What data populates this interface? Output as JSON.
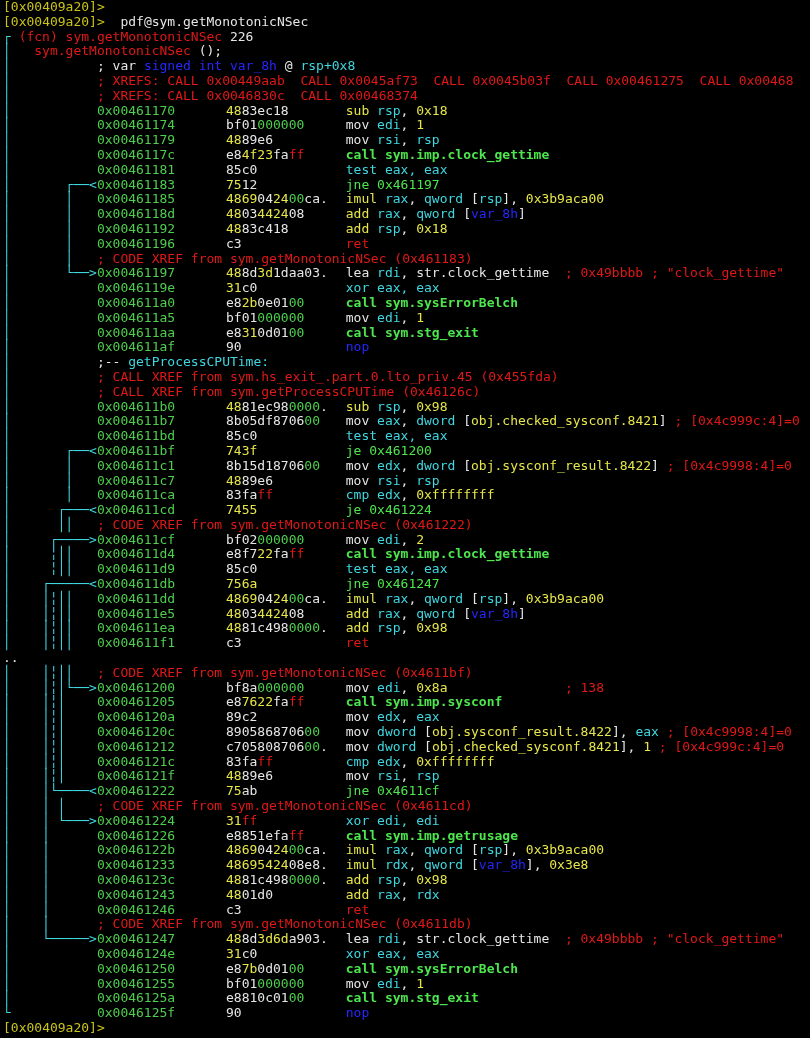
{
  "lines": [
    {
      "kind": "prompt",
      "prompt": "[0x00409a20]>"
    },
    {
      "kind": "prompt",
      "prompt": "[0x00409a20]>",
      "command": "pdf@sym.getMonotonicNSec"
    },
    {
      "kind": "header",
      "graph": "┌",
      "parts": [
        {
          "text": "(fcn) sym.getMonotonicNSec ",
          "kind": "fn"
        },
        {
          "text": "226",
          "kind": "punct"
        }
      ]
    },
    {
      "kind": "signature",
      "graph": "│",
      "parts": [
        {
          "text": "sym.getMonotonicNSec",
          "kind": "fn"
        },
        {
          "text": " ();",
          "kind": "punct"
        }
      ]
    },
    {
      "kind": "note",
      "graph": "│",
      "parts": [
        {
          "text": "; var ",
          "kind": "punct"
        },
        {
          "text": "signed int var_8h",
          "kind": "var"
        },
        {
          "text": " @ ",
          "kind": "punct"
        },
        {
          "text": "rsp+0x8",
          "kind": "reg"
        }
      ]
    },
    {
      "kind": "xref",
      "graph": "│",
      "parts": [
        {
          "text": "; XREFS: CALL 0x00449aab  CALL 0x0045af73  CALL 0x0045b03f  CALL 0x00461275  CALL 0x00468",
          "kind": "xref"
        }
      ]
    },
    {
      "kind": "xref",
      "graph": "│",
      "parts": [
        {
          "text": "; XREFS: CALL 0x0046830c  CALL 0x00468374",
          "kind": "xref"
        }
      ]
    },
    {
      "kind": "instr",
      "graph": "│",
      "addr": "0x00461170",
      "bytes": "4883ec18",
      "asm": [
        {
          "text": "sub ",
          "kind": "arith"
        },
        {
          "text": "rsp",
          "kind": "reg"
        },
        {
          "text": ", ",
          "kind": "punct"
        },
        {
          "text": "0x18",
          "kind": "num"
        }
      ]
    },
    {
      "kind": "instr",
      "graph": "│",
      "addr": "0x00461174",
      "bytes": "bf01000000",
      "asm": [
        {
          "text": "mov ",
          "kind": "op"
        },
        {
          "text": "edi",
          "kind": "reg"
        },
        {
          "text": ", ",
          "kind": "punct"
        },
        {
          "text": "1",
          "kind": "num"
        }
      ]
    },
    {
      "kind": "instr",
      "graph": "│",
      "addr": "0x00461179",
      "bytes": "4889e6",
      "asm": [
        {
          "text": "mov ",
          "kind": "op"
        },
        {
          "text": "rsi",
          "kind": "reg"
        },
        {
          "text": ", ",
          "kind": "punct"
        },
        {
          "text": "rsp",
          "kind": "reg"
        }
      ]
    },
    {
      "kind": "instr",
      "graph": "│",
      "addr": "0x0046117c",
      "bytes": "e84f23faff",
      "asm": [
        {
          "text": "call sym.imp.clock_gettime",
          "kind": "call"
        }
      ]
    },
    {
      "kind": "instr",
      "graph": "│",
      "addr": "0x00461181",
      "bytes": "85c0",
      "asm": [
        {
          "text": "test eax, eax",
          "kind": "logic"
        }
      ]
    },
    {
      "kind": "instr",
      "graph": "│       ┌──<",
      "addr": "0x00461183",
      "bytes": "7512",
      "asm": [
        {
          "text": "jne 0x461197",
          "kind": "jump"
        }
      ]
    },
    {
      "kind": "instr",
      "graph": "│       │",
      "addr": "0x00461185",
      "bytes": "4869042400ca.",
      "asm": [
        {
          "text": "imul ",
          "kind": "arith"
        },
        {
          "text": "rax",
          "kind": "reg"
        },
        {
          "text": ", ",
          "kind": "punct"
        },
        {
          "text": "qword ",
          "kind": "reg"
        },
        {
          "text": "[",
          "kind": "punct"
        },
        {
          "text": "rsp",
          "kind": "reg"
        },
        {
          "text": "], ",
          "kind": "punct"
        },
        {
          "text": "0x3b9aca00",
          "kind": "num"
        }
      ]
    },
    {
      "kind": "instr",
      "graph": "│       │",
      "addr": "0x0046118d",
      "bytes": "4803442408",
      "asm": [
        {
          "text": "add ",
          "kind": "arith"
        },
        {
          "text": "rax",
          "kind": "reg"
        },
        {
          "text": ", ",
          "kind": "punct"
        },
        {
          "text": "qword ",
          "kind": "reg"
        },
        {
          "text": "[",
          "kind": "punct"
        },
        {
          "text": "var_8h",
          "kind": "var"
        },
        {
          "text": "]",
          "kind": "punct"
        }
      ]
    },
    {
      "kind": "instr",
      "graph": "│       │",
      "addr": "0x00461192",
      "bytes": "4883c418",
      "asm": [
        {
          "text": "add ",
          "kind": "arith"
        },
        {
          "text": "rsp",
          "kind": "reg"
        },
        {
          "text": ", ",
          "kind": "punct"
        },
        {
          "text": "0x18",
          "kind": "num"
        }
      ]
    },
    {
      "kind": "instr",
      "graph": "│       │",
      "addr": "0x00461196",
      "bytes": "c3",
      "asm": [
        {
          "text": "ret",
          "kind": "ret"
        }
      ]
    },
    {
      "kind": "xref",
      "graph": "│       │",
      "parts": [
        {
          "text": "; CODE XREF from sym.getMonotonicNSec (0x461183)",
          "kind": "xref"
        }
      ]
    },
    {
      "kind": "instr",
      "graph": "│       └──>",
      "addr": "0x00461197",
      "bytes": "488d3d1daa03.",
      "asm": [
        {
          "text": "lea ",
          "kind": "op"
        },
        {
          "text": "rdi",
          "kind": "reg"
        },
        {
          "text": ", ",
          "kind": "punct"
        },
        {
          "text": "str.clock_gettime",
          "kind": "punct"
        }
      ],
      "comment": "; 0x49bbbb ; \"clock_gettime\""
    },
    {
      "kind": "instr",
      "graph": "│",
      "addr": "0x0046119e",
      "bytes": "31c0",
      "asm": [
        {
          "text": "xor eax, eax",
          "kind": "logic"
        }
      ]
    },
    {
      "kind": "instr",
      "graph": "│",
      "addr": "0x004611a0",
      "bytes": "e82b0e0100",
      "asm": [
        {
          "text": "call sym.sysErrorBelch",
          "kind": "call"
        }
      ]
    },
    {
      "kind": "instr",
      "graph": "│",
      "addr": "0x004611a5",
      "bytes": "bf01000000",
      "asm": [
        {
          "text": "mov ",
          "kind": "op"
        },
        {
          "text": "edi",
          "kind": "reg"
        },
        {
          "text": ", ",
          "kind": "punct"
        },
        {
          "text": "1",
          "kind": "num"
        }
      ]
    },
    {
      "kind": "instr",
      "graph": "│",
      "addr": "0x004611aa",
      "bytes": "e8310d0100",
      "asm": [
        {
          "text": "call sym.stg_exit",
          "kind": "call"
        }
      ]
    },
    {
      "kind": "instr",
      "graph": "│",
      "addr": "0x004611af",
      "bytes": "90",
      "asm": [
        {
          "text": "nop",
          "kind": "nop"
        }
      ]
    },
    {
      "kind": "label",
      "graph": "│",
      "parts": [
        {
          "text": ";-- ",
          "kind": "punct"
        },
        {
          "text": "getProcessCPUTime:",
          "kind": "reg"
        }
      ]
    },
    {
      "kind": "xref",
      "graph": "│",
      "parts": [
        {
          "text": "; CALL XREF from sym.hs_exit_.part.0.lto_priv.45 (0x455fda)",
          "kind": "xref"
        }
      ]
    },
    {
      "kind": "xref",
      "graph": "│",
      "parts": [
        {
          "text": "; CALL XREF from sym.getProcessCPUTime (0x46126c)",
          "kind": "xref"
        }
      ]
    },
    {
      "kind": "instr",
      "graph": "│",
      "addr": "0x004611b0",
      "bytes": "4881ec980000.",
      "asm": [
        {
          "text": "sub ",
          "kind": "arith"
        },
        {
          "text": "rsp",
          "kind": "reg"
        },
        {
          "text": ", ",
          "kind": "punct"
        },
        {
          "text": "0x98",
          "kind": "num"
        }
      ]
    },
    {
      "kind": "instr",
      "graph": "│",
      "addr": "0x004611b7",
      "bytes": "8b05df870600",
      "asm": [
        {
          "text": "mov ",
          "kind": "op"
        },
        {
          "text": "eax",
          "kind": "reg"
        },
        {
          "text": ", ",
          "kind": "punct"
        },
        {
          "text": "dword ",
          "kind": "reg"
        },
        {
          "text": "[",
          "kind": "punct"
        },
        {
          "text": "obj.checked_sysconf.8421",
          "kind": "obj"
        },
        {
          "text": "]",
          "kind": "punct"
        }
      ],
      "comment": "; [0x4c999c:4]=0"
    },
    {
      "kind": "instr",
      "graph": "│",
      "addr": "0x004611bd",
      "bytes": "85c0",
      "asm": [
        {
          "text": "test eax, eax",
          "kind": "logic"
        }
      ]
    },
    {
      "kind": "instr",
      "graph": "│       ┌──<",
      "addr": "0x004611bf",
      "bytes": "743f",
      "asm": [
        {
          "text": "je 0x461200",
          "kind": "jump"
        }
      ]
    },
    {
      "kind": "instr",
      "graph": "│       │",
      "addr": "0x004611c1",
      "bytes": "8b15d1870600",
      "asm": [
        {
          "text": "mov ",
          "kind": "op"
        },
        {
          "text": "edx",
          "kind": "reg"
        },
        {
          "text": ", ",
          "kind": "punct"
        },
        {
          "text": "dword ",
          "kind": "reg"
        },
        {
          "text": "[",
          "kind": "punct"
        },
        {
          "text": "obj.sysconf_result.8422",
          "kind": "obj"
        },
        {
          "text": "]",
          "kind": "punct"
        }
      ],
      "comment": "; [0x4c9998:4]=0"
    },
    {
      "kind": "instr",
      "graph": "│       │",
      "addr": "0x004611c7",
      "bytes": "4889e6",
      "asm": [
        {
          "text": "mov ",
          "kind": "op"
        },
        {
          "text": "rsi",
          "kind": "reg"
        },
        {
          "text": ", ",
          "kind": "punct"
        },
        {
          "text": "rsp",
          "kind": "reg"
        }
      ]
    },
    {
      "kind": "instr",
      "graph": "│       │",
      "addr": "0x004611ca",
      "bytes": "83faff",
      "asm": [
        {
          "text": "cmp ",
          "kind": "logic"
        },
        {
          "text": "edx",
          "kind": "reg"
        },
        {
          "text": ", ",
          "kind": "punct"
        },
        {
          "text": "0xffffffff",
          "kind": "num"
        }
      ]
    },
    {
      "kind": "instr",
      "graph": "│      ┌───<",
      "addr": "0x004611cd",
      "bytes": "7455",
      "asm": [
        {
          "text": "je 0x461224",
          "kind": "jump"
        }
      ]
    },
    {
      "kind": "xref",
      "graph": "│      ││",
      "parts": [
        {
          "text": "; CODE XREF from sym.getMonotonicNSec (0x461222)",
          "kind": "xref"
        }
      ]
    },
    {
      "kind": "instr",
      "graph": "│     ┌────>",
      "addr": "0x004611cf",
      "bytes": "bf02000000",
      "asm": [
        {
          "text": "mov ",
          "kind": "op"
        },
        {
          "text": "edi",
          "kind": "reg"
        },
        {
          "text": ", ",
          "kind": "punct"
        },
        {
          "text": "2",
          "kind": "num"
        }
      ]
    },
    {
      "kind": "instr",
      "graph": "│     ╎││",
      "addr": "0x004611d4",
      "bytes": "e8f722faff",
      "asm": [
        {
          "text": "call sym.imp.clock_gettime",
          "kind": "call"
        }
      ]
    },
    {
      "kind": "instr",
      "graph": "│     ╎││",
      "addr": "0x004611d9",
      "bytes": "85c0",
      "asm": [
        {
          "text": "test eax, eax",
          "kind": "logic"
        }
      ]
    },
    {
      "kind": "instr",
      "graph": "│    ┌─────<",
      "addr": "0x004611db",
      "bytes": "756a",
      "asm": [
        {
          "text": "jne 0x461247",
          "kind": "jump"
        }
      ]
    },
    {
      "kind": "instr",
      "graph": "│    │╎││",
      "addr": "0x004611dd",
      "bytes": "4869042400ca.",
      "asm": [
        {
          "text": "imul ",
          "kind": "arith"
        },
        {
          "text": "rax",
          "kind": "reg"
        },
        {
          "text": ", ",
          "kind": "punct"
        },
        {
          "text": "qword ",
          "kind": "reg"
        },
        {
          "text": "[",
          "kind": "punct"
        },
        {
          "text": "rsp",
          "kind": "reg"
        },
        {
          "text": "], ",
          "kind": "punct"
        },
        {
          "text": "0x3b9aca00",
          "kind": "num"
        }
      ]
    },
    {
      "kind": "instr",
      "graph": "│    │╎││",
      "addr": "0x004611e5",
      "bytes": "4803442408",
      "asm": [
        {
          "text": "add ",
          "kind": "arith"
        },
        {
          "text": "rax",
          "kind": "reg"
        },
        {
          "text": ", ",
          "kind": "punct"
        },
        {
          "text": "qword ",
          "kind": "reg"
        },
        {
          "text": "[",
          "kind": "punct"
        },
        {
          "text": "var_8h",
          "kind": "var"
        },
        {
          "text": "]",
          "kind": "punct"
        }
      ]
    },
    {
      "kind": "instr",
      "graph": "│    │╎││",
      "addr": "0x004611ea",
      "bytes": "4881c4980000.",
      "asm": [
        {
          "text": "add ",
          "kind": "arith"
        },
        {
          "text": "rsp",
          "kind": "reg"
        },
        {
          "text": ", ",
          "kind": "punct"
        },
        {
          "text": "0x98",
          "kind": "num"
        }
      ]
    },
    {
      "kind": "instr",
      "graph": "│    │╎││",
      "addr": "0x004611f1",
      "bytes": "c3",
      "asm": [
        {
          "text": "ret",
          "kind": "ret"
        }
      ]
    },
    {
      "kind": "dots",
      "text": ".."
    },
    {
      "kind": "xref",
      "graph": "│    │╎││",
      "parts": [
        {
          "text": "; CODE XREF from sym.getMonotonicNSec (0x4611bf)",
          "kind": "xref"
        }
      ]
    },
    {
      "kind": "instr",
      "graph": "│    │╎│└──>",
      "addr": "0x00461200",
      "bytes": "bf8a000000",
      "asm": [
        {
          "text": "mov ",
          "kind": "op"
        },
        {
          "text": "edi",
          "kind": "reg"
        },
        {
          "text": ", ",
          "kind": "punct"
        },
        {
          "text": "0x8a",
          "kind": "num"
        }
      ],
      "comment": "; 138"
    },
    {
      "kind": "instr",
      "graph": "│    │╎│",
      "addr": "0x00461205",
      "bytes": "e87622faff",
      "asm": [
        {
          "text": "call sym.imp.sysconf",
          "kind": "call"
        }
      ]
    },
    {
      "kind": "instr",
      "graph": "│    │╎│",
      "addr": "0x0046120a",
      "bytes": "89c2",
      "asm": [
        {
          "text": "mov ",
          "kind": "op"
        },
        {
          "text": "edx",
          "kind": "reg"
        },
        {
          "text": ", ",
          "kind": "punct"
        },
        {
          "text": "eax",
          "kind": "reg"
        }
      ]
    },
    {
      "kind": "instr",
      "graph": "│    │╎│",
      "addr": "0x0046120c",
      "bytes": "890586870600",
      "asm": [
        {
          "text": "mov ",
          "kind": "op"
        },
        {
          "text": "dword ",
          "kind": "reg"
        },
        {
          "text": "[",
          "kind": "punct"
        },
        {
          "text": "obj.sysconf_result.8422",
          "kind": "obj"
        },
        {
          "text": "], ",
          "kind": "punct"
        },
        {
          "text": "eax",
          "kind": "reg"
        }
      ],
      "comment": "; [0x4c9998:4]=0"
    },
    {
      "kind": "instr",
      "graph": "│    │╎│",
      "addr": "0x00461212",
      "bytes": "c70580870600.",
      "asm": [
        {
          "text": "mov ",
          "kind": "op"
        },
        {
          "text": "dword ",
          "kind": "reg"
        },
        {
          "text": "[",
          "kind": "punct"
        },
        {
          "text": "obj.checked_sysconf.8421",
          "kind": "obj"
        },
        {
          "text": "], ",
          "kind": "punct"
        },
        {
          "text": "1",
          "kind": "num"
        }
      ],
      "comment": "; [0x4c999c:4]=0"
    },
    {
      "kind": "instr",
      "graph": "│    │╎│",
      "addr": "0x0046121c",
      "bytes": "83faff",
      "asm": [
        {
          "text": "cmp ",
          "kind": "logic"
        },
        {
          "text": "edx",
          "kind": "reg"
        },
        {
          "text": ", ",
          "kind": "punct"
        },
        {
          "text": "0xffffffff",
          "kind": "num"
        }
      ]
    },
    {
      "kind": "instr",
      "graph": "│    │╎│",
      "addr": "0x0046121f",
      "bytes": "4889e6",
      "asm": [
        {
          "text": "mov ",
          "kind": "op"
        },
        {
          "text": "rsi",
          "kind": "reg"
        },
        {
          "text": ", ",
          "kind": "punct"
        },
        {
          "text": "rsp",
          "kind": "reg"
        }
      ]
    },
    {
      "kind": "instr",
      "graph": "│    │└────<",
      "addr": "0x00461222",
      "bytes": "75ab",
      "asm": [
        {
          "text": "jne 0x4611cf",
          "kind": "jump"
        }
      ]
    },
    {
      "kind": "xref",
      "graph": "│    │ │",
      "parts": [
        {
          "text": "; CODE XREF from sym.getMonotonicNSec (0x4611cd)",
          "kind": "xref"
        }
      ]
    },
    {
      "kind": "instr",
      "graph": "│    │ └───>",
      "addr": "0x00461224",
      "bytes": "31ff",
      "asm": [
        {
          "text": "xor edi, edi",
          "kind": "logic"
        }
      ]
    },
    {
      "kind": "instr",
      "graph": "│    │",
      "addr": "0x00461226",
      "bytes": "e8851efaff",
      "asm": [
        {
          "text": "call sym.imp.getrusage",
          "kind": "call"
        }
      ]
    },
    {
      "kind": "instr",
      "graph": "│    │",
      "addr": "0x0046122b",
      "bytes": "4869042400ca.",
      "asm": [
        {
          "text": "imul ",
          "kind": "arith"
        },
        {
          "text": "rax",
          "kind": "reg"
        },
        {
          "text": ", ",
          "kind": "punct"
        },
        {
          "text": "qword ",
          "kind": "reg"
        },
        {
          "text": "[",
          "kind": "punct"
        },
        {
          "text": "rsp",
          "kind": "reg"
        },
        {
          "text": "], ",
          "kind": "punct"
        },
        {
          "text": "0x3b9aca00",
          "kind": "num"
        }
      ]
    },
    {
      "kind": "instr",
      "graph": "│    │",
      "addr": "0x00461233",
      "bytes": "4869542408e8.",
      "asm": [
        {
          "text": "imul ",
          "kind": "arith"
        },
        {
          "text": "rdx",
          "kind": "reg"
        },
        {
          "text": ", ",
          "kind": "punct"
        },
        {
          "text": "qword ",
          "kind": "reg"
        },
        {
          "text": "[",
          "kind": "punct"
        },
        {
          "text": "var_8h",
          "kind": "var"
        },
        {
          "text": "], ",
          "kind": "punct"
        },
        {
          "text": "0x3e8",
          "kind": "num"
        }
      ]
    },
    {
      "kind": "instr",
      "graph": "│    │",
      "addr": "0x0046123c",
      "bytes": "4881c4980000.",
      "asm": [
        {
          "text": "add ",
          "kind": "arith"
        },
        {
          "text": "rsp",
          "kind": "reg"
        },
        {
          "text": ", ",
          "kind": "punct"
        },
        {
          "text": "0x98",
          "kind": "num"
        }
      ]
    },
    {
      "kind": "instr",
      "graph": "│    │",
      "addr": "0x00461243",
      "bytes": "4801d0",
      "asm": [
        {
          "text": "add ",
          "kind": "arith"
        },
        {
          "text": "rax",
          "kind": "reg"
        },
        {
          "text": ", ",
          "kind": "punct"
        },
        {
          "text": "rdx",
          "kind": "reg"
        }
      ]
    },
    {
      "kind": "instr",
      "graph": "│    │",
      "addr": "0x00461246",
      "bytes": "c3",
      "asm": [
        {
          "text": "ret",
          "kind": "ret"
        }
      ]
    },
    {
      "kind": "xref",
      "graph": "│    │",
      "parts": [
        {
          "text": "; CODE XREF from sym.getMonotonicNSec (0x4611db)",
          "kind": "xref"
        }
      ]
    },
    {
      "kind": "instr",
      "graph": "│    └─────>",
      "addr": "0x00461247",
      "bytes": "488d3d6da903.",
      "asm": [
        {
          "text": "lea ",
          "kind": "op"
        },
        {
          "text": "rdi",
          "kind": "reg"
        },
        {
          "text": ", ",
          "kind": "punct"
        },
        {
          "text": "str.clock_gettime",
          "kind": "punct"
        }
      ],
      "comment": "; 0x49bbbb ; \"clock_gettime\""
    },
    {
      "kind": "instr",
      "graph": "│",
      "addr": "0x0046124e",
      "bytes": "31c0",
      "asm": [
        {
          "text": "xor eax, eax",
          "kind": "logic"
        }
      ]
    },
    {
      "kind": "instr",
      "graph": "│",
      "addr": "0x00461250",
      "bytes": "e87b0d0100",
      "asm": [
        {
          "text": "call sym.sysErrorBelch",
          "kind": "call"
        }
      ]
    },
    {
      "kind": "instr",
      "graph": "│",
      "addr": "0x00461255",
      "bytes": "bf01000000",
      "asm": [
        {
          "text": "mov ",
          "kind": "op"
        },
        {
          "text": "edi",
          "kind": "reg"
        },
        {
          "text": ", ",
          "kind": "punct"
        },
        {
          "text": "1",
          "kind": "num"
        }
      ]
    },
    {
      "kind": "instr",
      "graph": "│",
      "addr": "0x0046125a",
      "bytes": "e8810c0100",
      "asm": [
        {
          "text": "call sym.stg_exit",
          "kind": "call"
        }
      ]
    },
    {
      "kind": "instr",
      "graph": "└",
      "addr": "0x0046125f",
      "bytes": "90",
      "asm": [
        {
          "text": "nop",
          "kind": "nop"
        }
      ]
    },
    {
      "kind": "prompt",
      "prompt": "[0x00409a20]>"
    }
  ]
}
